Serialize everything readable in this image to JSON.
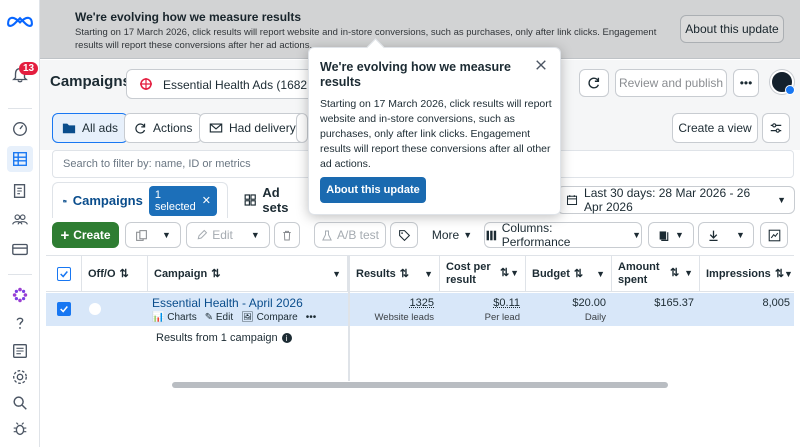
{
  "notifications": {
    "count": "13"
  },
  "banner": {
    "title": "We're evolving how we measure results",
    "body": "Starting on 17 March 2026, click results will report website and in-store conversions, such as purchases, only after link clicks. Engagement results will report these conversions after her ad actions.",
    "button": "About this update"
  },
  "header": {
    "title": "Campaigns",
    "account": "Essential Health Ads (1682...",
    "review_button": "Review and publish",
    "more_label": "•••"
  },
  "filters": {
    "all_ads": "All ads",
    "actions": "Actions",
    "had_delivery": "Had delivery",
    "create_view": "Create a view"
  },
  "search": {
    "placeholder": "Search to filter by: name, ID or metrics"
  },
  "tabs": {
    "campaigns": "Campaigns",
    "selected_badge": "1 selected",
    "ad_sets": "Ad sets",
    "date_range": "Last 30 days: 28 Mar 2026 - 26 Apr 2026"
  },
  "toolbar": {
    "create": "Create",
    "edit": "Edit",
    "ab_test": "A/B test",
    "more": "More",
    "columns": "Columns: Performance"
  },
  "table": {
    "headers": {
      "off_on": "Off/O",
      "campaign": "Campaign",
      "results": "Results",
      "cost_per_result": "Cost per result",
      "budget": "Budget",
      "amount_spent": "Amount spent",
      "impressions": "Impressions"
    },
    "row": {
      "name": "Essential Health - April 2026",
      "charts": "Charts",
      "edit": "Edit",
      "compare": "Compare",
      "results": "1325",
      "results_sub": "Website leads",
      "cost": "$0.11",
      "cost_sub": "Per lead",
      "budget": "$20.00",
      "budget_sub": "Daily",
      "spent": "$165.37",
      "impressions": "8,005"
    },
    "footer": "Results from 1 campaign"
  },
  "popover": {
    "title": "We're evolving how we measure results",
    "body": "Starting on 17 March 2026, click results will report website and in-store conversions, such as purchases, only after link clicks. Engagement results will report these conversions after all other ad actions.",
    "button": "About this update"
  }
}
